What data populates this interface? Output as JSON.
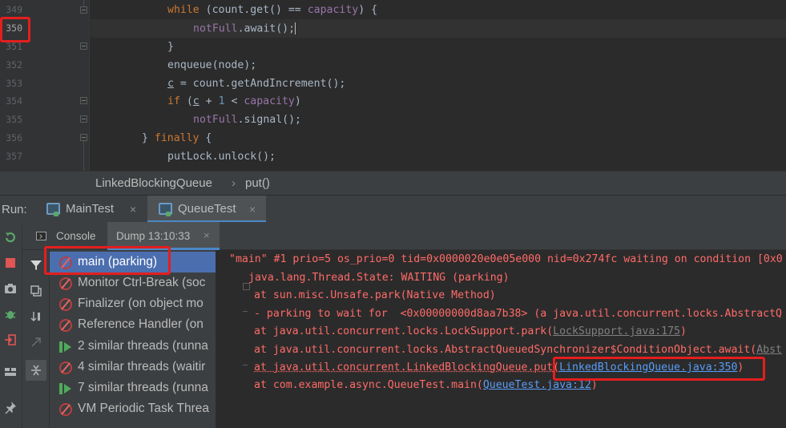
{
  "editor": {
    "line_numbers": [
      "349",
      "350",
      "351",
      "352",
      "353",
      "354",
      "355",
      "356",
      "357"
    ],
    "current_line": "350",
    "code": {
      "l349": {
        "kw": "while",
        "a": " (count.get() == ",
        "fld": "capacity",
        "b": ") {"
      },
      "l350": {
        "fld": "notFull",
        "a": ".await();"
      },
      "l351": {
        "a": "}"
      },
      "l352": {
        "a": "enqueue(node);"
      },
      "l353": {
        "c": "c",
        "a": " = count.getAndIncrement();"
      },
      "l354": {
        "kw": "if",
        "a": " (",
        "c": "c",
        "b": " + ",
        "num": "1",
        "d": " < ",
        "fld": "capacity",
        "e": ")"
      },
      "l355": {
        "fld": "notFull",
        "a": ".signal();"
      },
      "l356": {
        "a": "} ",
        "kw": "finally",
        "b": " {"
      },
      "l357": {
        "a": "putLock.unlock();"
      }
    }
  },
  "breadcrumb": {
    "class_name": "LinkedBlockingQueue",
    "separator": "›",
    "method": "put()"
  },
  "run": {
    "label": "Run:",
    "tabs": [
      {
        "label": "MainTest",
        "close": "×"
      },
      {
        "label": "QueueTest",
        "close": "×"
      }
    ]
  },
  "sub_tabs": {
    "console": "Console",
    "dump": "Dump 13:10:33",
    "dump_close": "×"
  },
  "threads": [
    {
      "label": "main (parking)",
      "icon": "parked-thread-icon"
    },
    {
      "label": "Monitor Ctrl-Break (soc",
      "icon": "parked-thread-icon"
    },
    {
      "label": "Finalizer (on object mo",
      "icon": "parked-thread-icon"
    },
    {
      "label": "Reference Handler (on",
      "icon": "parked-thread-icon"
    },
    {
      "label": "2 similar threads (runna",
      "icon": "running-thread-icon"
    },
    {
      "label": "4 similar threads (waitir",
      "icon": "parked-thread-icon"
    },
    {
      "label": "7 similar threads (runna",
      "icon": "running-thread-icon"
    },
    {
      "label": "VM Periodic Task Threa",
      "icon": "parked-thread-icon"
    }
  ],
  "dump": {
    "header": "\"main\" #1 prio=5 os_prio=0 tid=0x0000020e0e05e000 nid=0x274fc waiting on condition [0x0",
    "state": "java.lang.Thread.State: WAITING (parking)",
    "frame1": "at sun.misc.Unsafe.park(Native Method)",
    "frame2": "- parking to wait for  <0x00000000d8aa7b38> (a java.util.concurrent.locks.AbstractQ",
    "frame3_prefix": "at java.util.concurrent.locks.LockSupport.park(",
    "frame3_link": "LockSupport.java:175",
    "frame3_suffix": ")",
    "frame4_prefix": "at java.util.concurrent.locks.AbstractQueuedSynchronizer$ConditionObject.await(",
    "frame4_link": "Abst",
    "frame5_prefix": "at java.util.concurrent.LinkedBlockingQueue.put(",
    "frame5_link": "LinkedBlockingQueue.java:350",
    "frame5_suffix": ")",
    "frame6_prefix": "at com.example.async.QueueTest.main(",
    "frame6_link": "QueueTest.java:12",
    "frame6_suffix": ")"
  },
  "colors": {
    "accent": "#4a88c7",
    "highlight": "#e41e1e",
    "error_text": "#ff6b68",
    "link": "#589df6"
  }
}
